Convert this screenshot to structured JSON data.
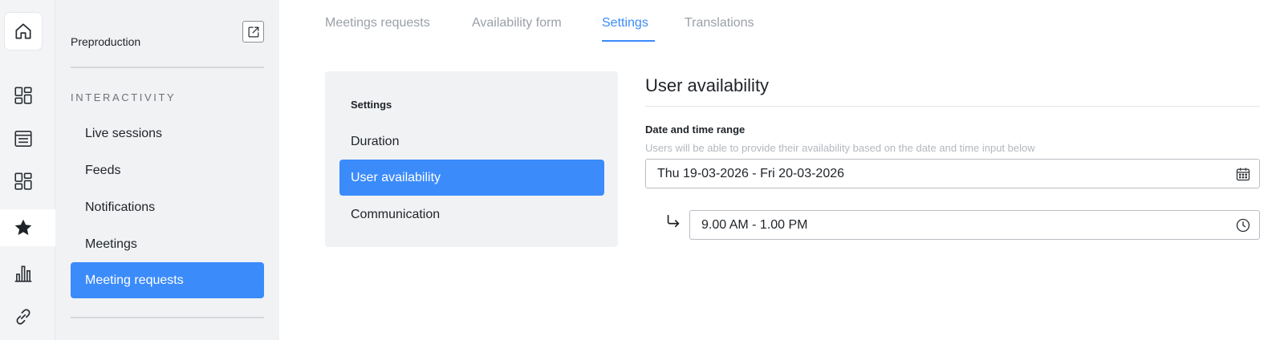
{
  "rail": {
    "items": [
      {
        "icon": "home-icon"
      },
      {
        "icon": "dashboard-icon"
      },
      {
        "icon": "list-icon"
      },
      {
        "icon": "grid-icon"
      },
      {
        "icon": "star-icon",
        "active": true
      },
      {
        "icon": "bar-chart-icon"
      },
      {
        "icon": "link-icon"
      }
    ]
  },
  "sidebar": {
    "project": "Preproduction",
    "section_label": "INTERACTIVITY",
    "items": [
      {
        "label": "Live sessions"
      },
      {
        "label": "Feeds"
      },
      {
        "label": "Notifications"
      },
      {
        "label": "Meetings"
      },
      {
        "label": "Meeting requests",
        "active": true
      }
    ]
  },
  "tabs": [
    {
      "label": "Meetings requests"
    },
    {
      "label": "Availability form"
    },
    {
      "label": "Settings",
      "active": true
    },
    {
      "label": "Translations"
    }
  ],
  "settings_panel": {
    "title": "Settings",
    "items": [
      {
        "label": "Duration"
      },
      {
        "label": "User availability",
        "active": true
      },
      {
        "label": "Communication"
      }
    ]
  },
  "content": {
    "title": "User availability",
    "field_label": "Date and time range",
    "field_help": "Users will be able to provide their availability based on the date and time input below",
    "date_range": "Thu 19-03-2026 - Fri 20-03-2026",
    "time_range": "9.00 AM - 1.00 PM"
  },
  "colors": {
    "accent": "#3b8bfb",
    "sidebar_bg": "#f1f2f4",
    "muted_text": "#9aa0a8"
  }
}
